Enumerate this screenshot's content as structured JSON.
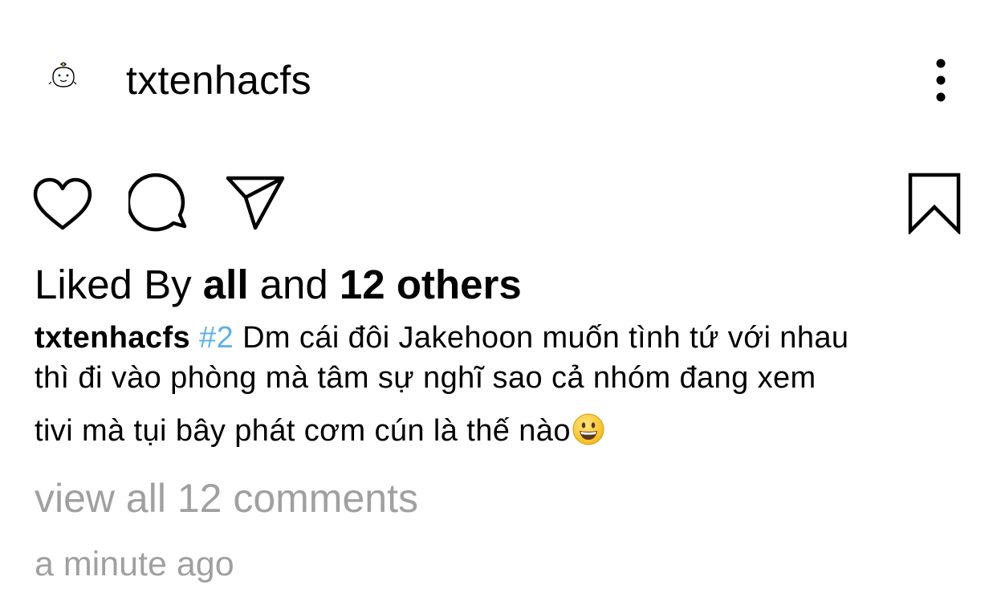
{
  "header": {
    "username": "txtenhacfs",
    "avatar_icon": "doodle-avatar-icon",
    "more_icon": "more-vertical-icon"
  },
  "actions": {
    "like_icon": "heart-icon",
    "comment_icon": "comment-bubble-icon",
    "share_icon": "paper-plane-icon",
    "save_icon": "bookmark-icon"
  },
  "likes": {
    "prefix": "Liked By ",
    "user": "all",
    "joiner": " and ",
    "others": "12 others"
  },
  "caption": {
    "username": "txtenhacfs",
    "hashtag": "#2",
    "line1_text": " Dm cái đôi Jakehoon muốn tình tứ với nhau",
    "line2": "thì đi vào phòng mà tâm sự nghĩ sao cả nhóm đang xem",
    "line3": "tivi mà tụi bây phát cơm cún là thế nào",
    "emoji": "grinning-face-emoji"
  },
  "comments": {
    "view_all": "view all 12 comments"
  },
  "timestamp": "a minute ago",
  "colors": {
    "hashtag": "#5fb0ea",
    "muted": "#a0a0a0",
    "text": "#000000",
    "background": "#ffffff"
  }
}
